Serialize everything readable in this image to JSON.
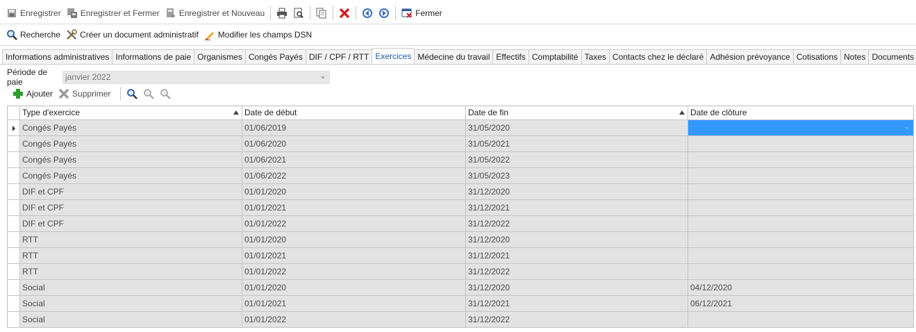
{
  "toolbar1": {
    "save": "Enregistrer",
    "save_close": "Enregistrer et Fermer",
    "save_new": "Enregistrer et Nouveau",
    "close": "Fermer"
  },
  "toolbar2": {
    "search": "Recherche",
    "create_doc": "Créer un document administratif",
    "edit_dsn": "Modifier les champs DSN"
  },
  "tabs": [
    "Informations administratives",
    "Informations de paie",
    "Organismes",
    "Congés Payés",
    "DIF / CPF / RTT",
    "Exercices",
    "Médecine du travail",
    "Effectifs",
    "Comptabilité",
    "Taxes",
    "Contacts chez le déclaré",
    "Adhésion prévoyance",
    "Cotisations",
    "Notes",
    "Documents associés"
  ],
  "active_tab": "Exercices",
  "period": {
    "label": "Période de paie",
    "value": "janvier 2022"
  },
  "gridbar": {
    "add": "Ajouter",
    "delete": "Supprimer"
  },
  "grid": {
    "columns": [
      "Type d'exercice",
      "Date de début",
      "Date de fin",
      "Date de clôture"
    ],
    "rows": [
      [
        "Congés Payés",
        "01/06/2019",
        "31/05/2020",
        ""
      ],
      [
        "Congés Payés",
        "01/06/2020",
        "31/05/2021",
        ""
      ],
      [
        "Congés Payés",
        "01/06/2021",
        "31/05/2022",
        ""
      ],
      [
        "Congés Payés",
        "01/06/2022",
        "31/05/2023",
        ""
      ],
      [
        "DIF et CPF",
        "01/01/2020",
        "31/12/2020",
        ""
      ],
      [
        "DIF et CPF",
        "01/01/2021",
        "31/12/2021",
        ""
      ],
      [
        "DIF et CPF",
        "01/01/2022",
        "31/12/2022",
        ""
      ],
      [
        "RTT",
        "01/01/2020",
        "31/12/2020",
        ""
      ],
      [
        "RTT",
        "01/01/2021",
        "31/12/2021",
        ""
      ],
      [
        "RTT",
        "01/01/2022",
        "31/12/2022",
        ""
      ],
      [
        "Social",
        "01/01/2020",
        "31/12/2020",
        "04/12/2020"
      ],
      [
        "Social",
        "01/01/2021",
        "31/12/2021",
        "06/12/2021"
      ],
      [
        "Social",
        "01/01/2022",
        "31/12/2022",
        ""
      ]
    ],
    "selected_color": "#3399ff"
  }
}
